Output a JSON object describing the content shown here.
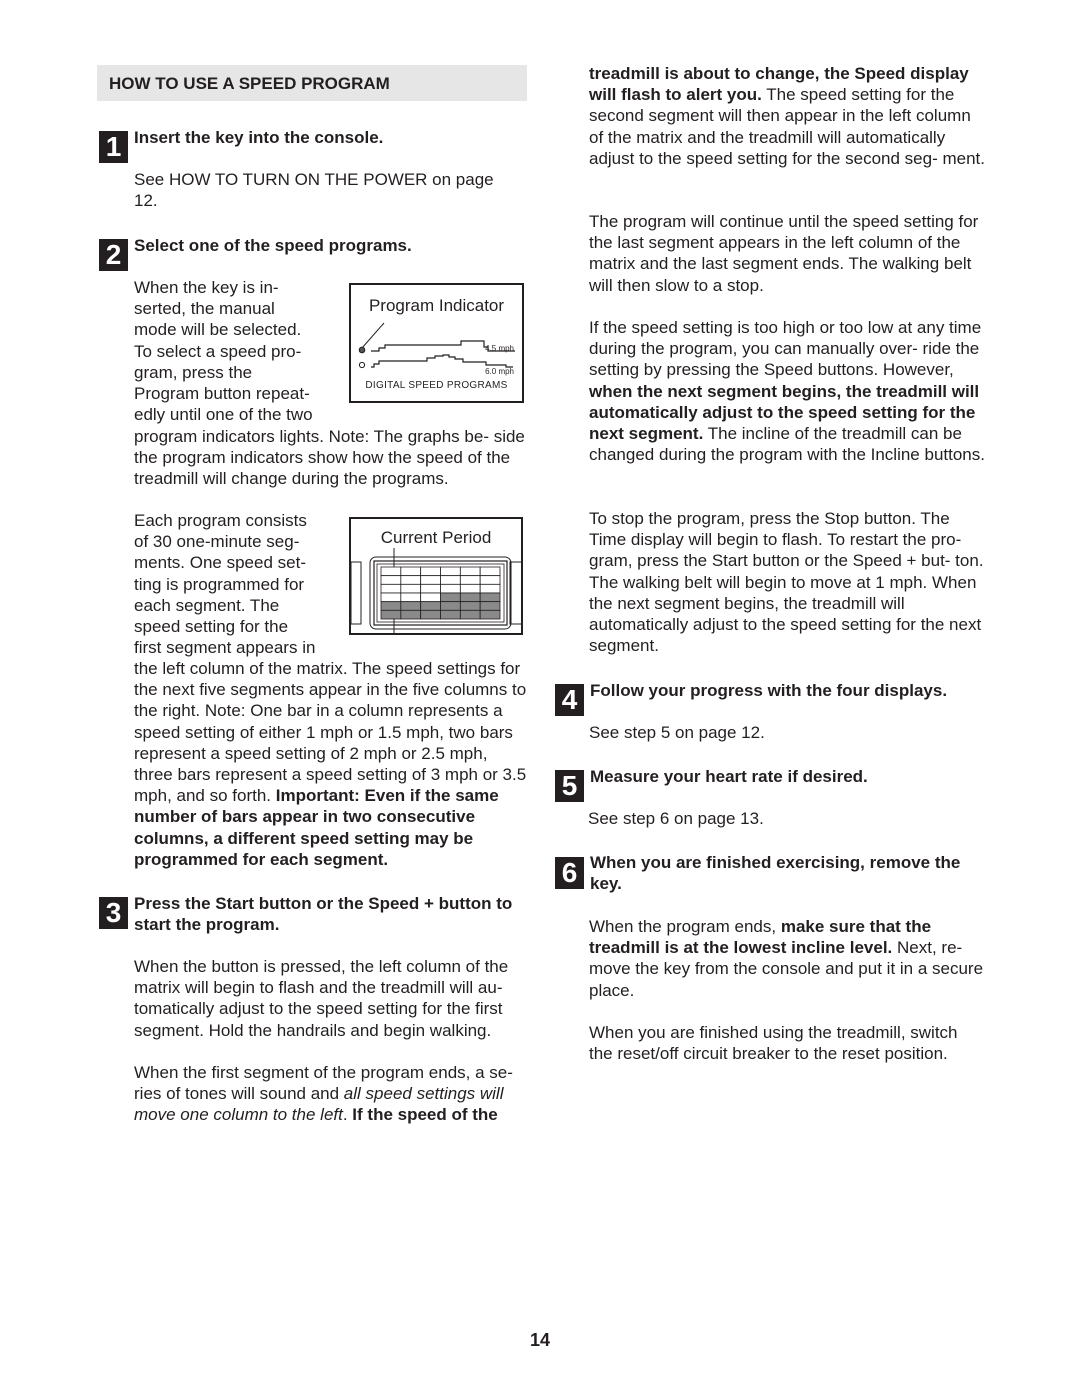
{
  "section": {
    "title": "HOW TO USE A SPEED PROGRAM"
  },
  "steps": [
    {
      "number": "1",
      "heading": "Insert the key into the console.",
      "body": "See HOW TO TURN ON THE POWER on page 12."
    },
    {
      "number": "2",
      "heading": "Select one of the speed programs.",
      "para1_lines": [
        "When the key is in-",
        "serted, the manual",
        "mode will be selected.",
        "To select a speed pro-",
        "gram, press the",
        "Program button repeat-",
        "edly until one of the two"
      ],
      "para1_tail": "program indicators lights. Note: The graphs be- side the program indicators show how the speed of the treadmill will change during the programs.",
      "para2_lines": [
        "Each program consists",
        "of 30 one-minute seg-",
        "ments. One speed set-",
        "ting is programmed for",
        "each segment. The",
        "speed setting for the",
        "first segment appears in"
      ],
      "para2_tail": "the left column of the matrix. The speed settings for the next five segments appear in the five columns to the right. Note: One bar in a column represents a speed setting of either 1 mph or 1.5 mph, two bars represent a speed setting of 2 mph or 2.5 mph, three bars represent a speed setting of 3 mph or 3.5 mph, and so forth.",
      "para2_bold": "Important: Even if the same number of bars appear in two consecutive columns, a different speed setting may be programmed for each segment."
    },
    {
      "number": "3",
      "heading": "Press the Start button or the Speed + button to start the program.",
      "para1": "When the button is pressed, the left column of the matrix will begin to flash and the treadmill will au- tomatically adjust to the speed setting for the first segment. Hold the handrails and begin walking.",
      "para2_start": "When the first segment of the program ends, a se- ries of tones will sound and ",
      "para2_italic": "all speed settings will move one column to the left",
      "para2_period": ". ",
      "para2_bold": "If the speed of the treadmill is about to change, the Speed display will flash to alert you.",
      "para2_end": " The speed setting for the second segment will then appear in the left column of the matrix and the treadmill will automatically adjust to the speed setting for the second seg- ment.",
      "para3": "The program will continue until the speed setting for the last segment appears in the left column of the matrix and the last segment ends. The walking belt will then slow to a stop.",
      "para4_start": "If the speed setting is too high or too low at any time during the program, you can manually over- ride the setting by pressing the Speed buttons. However, ",
      "para4_bold": "when the next segment begins, the treadmill will automatically adjust to the speed setting for the next segment.",
      "para4_end": " The incline of the treadmill can be changed during the program with the Incline buttons.",
      "para5": "To stop the program, press the Stop button. The Time display will begin to flash. To restart the pro- gram, press the Start button or the Speed + but- ton. The walking belt will begin to move at 1 mph. When the next segment begins, the treadmill will automatically adjust to the speed setting for the next segment."
    },
    {
      "number": "4",
      "heading": "Follow your progress with the four displays.",
      "body": "See step 5 on page 12."
    },
    {
      "number": "5",
      "heading": "Measure your heart rate if desired.",
      "body": "See step 6 on page 13."
    },
    {
      "number": "6",
      "heading": "When you are finished exercising, remove the key.",
      "para1_start": "When the program ends, ",
      "para1_bold": "make sure that the treadmill is at the lowest incline level.",
      "para1_end": " Next, re- move the key from the console and put it in a secure place.",
      "para2": "When you are finished using the treadmill, switch the reset/off circuit breaker to the reset position."
    }
  ],
  "figure_program_indicator": {
    "title": "Program Indicator",
    "program1_speed": "4.5 mph",
    "program2_speed": "6.0 mph",
    "caption": "DIGITAL SPEED PROGRAMS"
  },
  "figure_current_period": {
    "title": "Current Period",
    "columns": 6,
    "rows": 6,
    "lit_bars_per_column": [
      2,
      2,
      2,
      3,
      3,
      3
    ]
  },
  "page_number": "14"
}
